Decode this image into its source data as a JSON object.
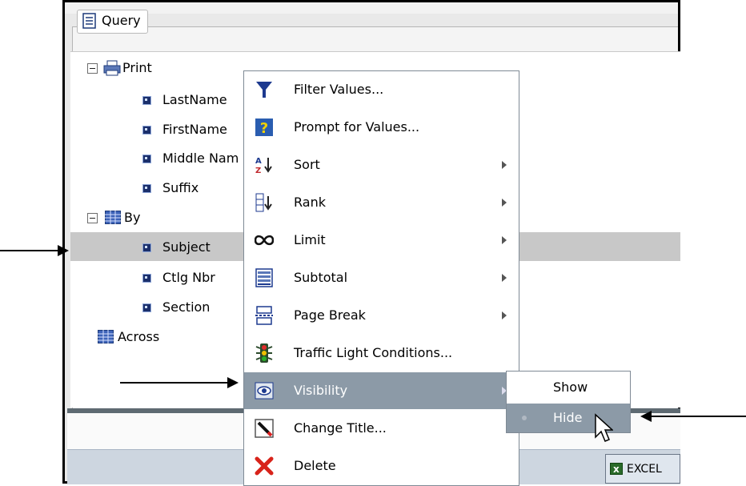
{
  "panel": {
    "title": "Query"
  },
  "tree": {
    "print": {
      "label": "Print",
      "fields": [
        "LastName",
        "FirstName",
        "Middle Nam",
        "Suffix"
      ]
    },
    "by": {
      "label": "By",
      "fields": [
        "Subject",
        "Ctlg Nbr",
        "Section"
      ]
    },
    "across": {
      "label": "Across"
    }
  },
  "context_menu": {
    "items": [
      {
        "label": "Filter Values...",
        "icon": "funnel-icon"
      },
      {
        "label": "Prompt for Values...",
        "icon": "question-icon"
      },
      {
        "label": "Sort",
        "icon": "sort-az-icon",
        "submenu": true
      },
      {
        "label": "Rank",
        "icon": "rank-icon",
        "submenu": true
      },
      {
        "label": "Limit",
        "icon": "infinity-icon",
        "submenu": true
      },
      {
        "label": "Subtotal",
        "icon": "subtotal-icon",
        "submenu": true
      },
      {
        "label": "Page Break",
        "icon": "page-break-icon",
        "submenu": true
      },
      {
        "label": "Traffic Light Conditions...",
        "icon": "traffic-light-icon"
      },
      {
        "label": "Visibility",
        "icon": "eye-icon",
        "submenu": true,
        "active": true
      },
      {
        "label": "Change Title...",
        "icon": "pencil-icon"
      },
      {
        "label": "Delete",
        "icon": "delete-x-icon"
      }
    ]
  },
  "visibility_submenu": {
    "items": [
      {
        "label": "Show"
      },
      {
        "label": "Hide",
        "active": true
      }
    ]
  },
  "status_bar": {
    "excel_button": "EXCEL"
  },
  "colors": {
    "menu_highlight": "#8c9aa7",
    "row_highlight": "#c8c8c8",
    "field_icon": "#1b2f6b"
  }
}
